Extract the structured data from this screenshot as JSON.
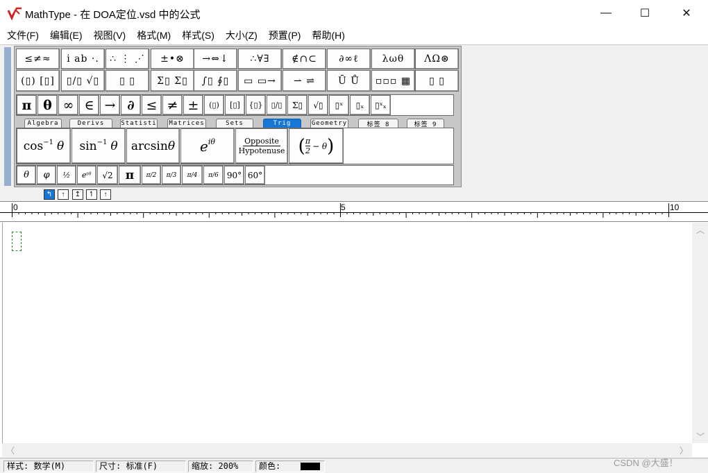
{
  "window": {
    "title": "MathType - 在 DOA定位.vsd 中的公式",
    "minimize_glyph": "—",
    "maximize_glyph": "☐",
    "close_glyph": "✕"
  },
  "menu": [
    "文件(F)",
    "编辑(E)",
    "视图(V)",
    "格式(M)",
    "样式(S)",
    "大小(Z)",
    "预置(P)",
    "帮助(H)"
  ],
  "palette": {
    "row1": [
      "≤≠≈",
      "i ab ·.",
      "∴ ⋮ ⋰",
      "±•⊗",
      "→⇔↓",
      "∴∀∃",
      "∉∩⊂",
      "∂∞ℓ",
      "λωθ",
      "ΛΩ⊛"
    ],
    "row2": [
      "(▯) [▯]",
      "▯/▯ √▯",
      "▯ ▯",
      "Σ▯ Σ▯",
      "∫▯ ∮▯",
      "▭ ▭→",
      "⇀ ⇌",
      "Ū Ů",
      "▫▫▫ ▦",
      "▯ ▯"
    ],
    "small_row": [
      "π",
      "θ",
      "∞",
      "∈",
      "→",
      "∂",
      "≤",
      "≠",
      "±",
      "(▯)",
      "[▯]",
      "{▯}",
      "▯/▯",
      "Σ▯",
      "√▯",
      "▯ˣ",
      "▯ₓ",
      "▯ˣₓ"
    ],
    "tabs": [
      "Algebra",
      "Derivs",
      "Statisti",
      "Matrices",
      "Sets",
      "Trig",
      "Geometry",
      "标签 8",
      "标签 9"
    ],
    "active_tab": "Trig",
    "templates": [
      {
        "main": "cos",
        "sup": "−1",
        "var": "θ"
      },
      {
        "main": "sin",
        "sup": "−1",
        "var": "θ"
      },
      {
        "main": "arcsin",
        "sup": "",
        "var": "θ"
      },
      {
        "main": "e",
        "sup": "iθ",
        "var": ""
      },
      {
        "main": "Opposite",
        "sup": "Hypotenuse",
        "var": ""
      },
      {
        "main": "π",
        "sup": "2",
        "var": "− θ"
      }
    ],
    "bottom_row": [
      "θ",
      "φ",
      "½",
      "eⁱᶿ",
      "√2",
      "π",
      "π/2",
      "π/3",
      "π/4",
      "π/6",
      "90°",
      "60°"
    ]
  },
  "structure_buttons": [
    "↰",
    "↑",
    "↥",
    "↿",
    "↑"
  ],
  "ruler": {
    "labels": [
      "0",
      "5",
      "10"
    ]
  },
  "status": {
    "style": "样式: 数学(M)",
    "size": "尺寸: 标准(F)",
    "zoom": "缩放: 200%",
    "color_label": "颜色:",
    "color_value": "#000000"
  },
  "watermark": "CSDN @大盛！",
  "accent": "#1677d6"
}
